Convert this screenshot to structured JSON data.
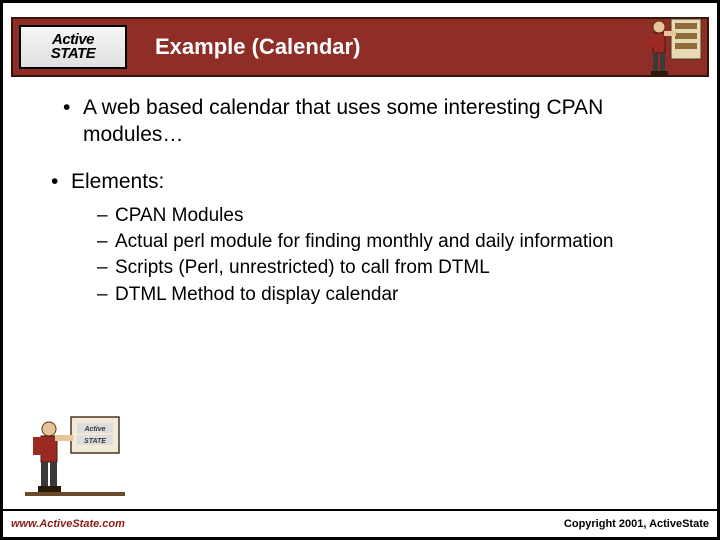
{
  "header": {
    "logo_line1": "Active",
    "logo_line2": "STATE",
    "title": "Example (Calendar)"
  },
  "bullets": [
    {
      "text": "A web based calendar that uses some interesting CPAN modules…",
      "children": []
    },
    {
      "text": "Elements:",
      "children": [
        "CPAN Modules",
        "Actual perl module for finding monthly and daily information",
        "Scripts (Perl, unrestricted) to call from DTML",
        "DTML Method to display calendar"
      ]
    }
  ],
  "footer": {
    "url": "www.ActiveState.com",
    "copyright": "Copyright 2001, ActiveState"
  }
}
